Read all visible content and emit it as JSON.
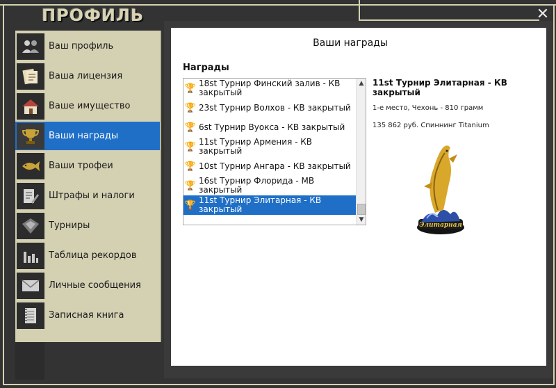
{
  "window": {
    "title": "ПРОФИЛЬ",
    "close_symbol": "✕"
  },
  "sidebar": {
    "items": [
      {
        "label": "Ваш профиль",
        "icon": "users-icon",
        "active": false
      },
      {
        "label": "Ваша лицензия",
        "icon": "license-icon",
        "active": false
      },
      {
        "label": "Ваше имущество",
        "icon": "house-icon",
        "active": false
      },
      {
        "label": "Ваши награды",
        "icon": "trophy-icon",
        "active": true
      },
      {
        "label": "Ваши трофеи",
        "icon": "fish-icon",
        "active": false
      },
      {
        "label": "Штрафы и налоги",
        "icon": "document-pen-icon",
        "active": false
      },
      {
        "label": "Турниры",
        "icon": "tournament-icon",
        "active": false
      },
      {
        "label": "Таблица рекордов",
        "icon": "bar-chart-icon",
        "active": false
      },
      {
        "label": "Личные сообщения",
        "icon": "envelope-icon",
        "active": false
      },
      {
        "label": "Записная книга",
        "icon": "notebook-icon",
        "active": false
      }
    ]
  },
  "main": {
    "title": "Ваши награды",
    "list_heading": "Награды",
    "awards": [
      {
        "label": "18st Турнир Финский залив - КВ закрытый",
        "icon": "trophy-icon",
        "selected": false
      },
      {
        "label": "23st Турнир Волхов - КВ закрытый",
        "icon": "trophy-icon",
        "selected": false
      },
      {
        "label": "6st Турнир Вуокса - КВ закрытый",
        "icon": "trophy-icon",
        "selected": false
      },
      {
        "label": "11st Турнир Армения - КВ закрытый",
        "icon": "trophy-icon",
        "selected": false
      },
      {
        "label": "10st Турнир Ангара - КВ закрытый",
        "icon": "trophy-icon",
        "selected": false
      },
      {
        "label": "16st Турнир Флорида - МВ закрытый",
        "icon": "trophy-icon",
        "selected": false
      },
      {
        "label": "11st Турнир Элитарная - КВ закрытый",
        "icon": "trophy-icon",
        "selected": true
      }
    ],
    "detail": {
      "title": "11st Турнир Элитарная - КВ закрытый",
      "line1": "1-е место, Чехонь - 810 грамм",
      "line2": "135 862 руб. Спиннинг Titanium",
      "image_label": "Элитарная"
    }
  }
}
